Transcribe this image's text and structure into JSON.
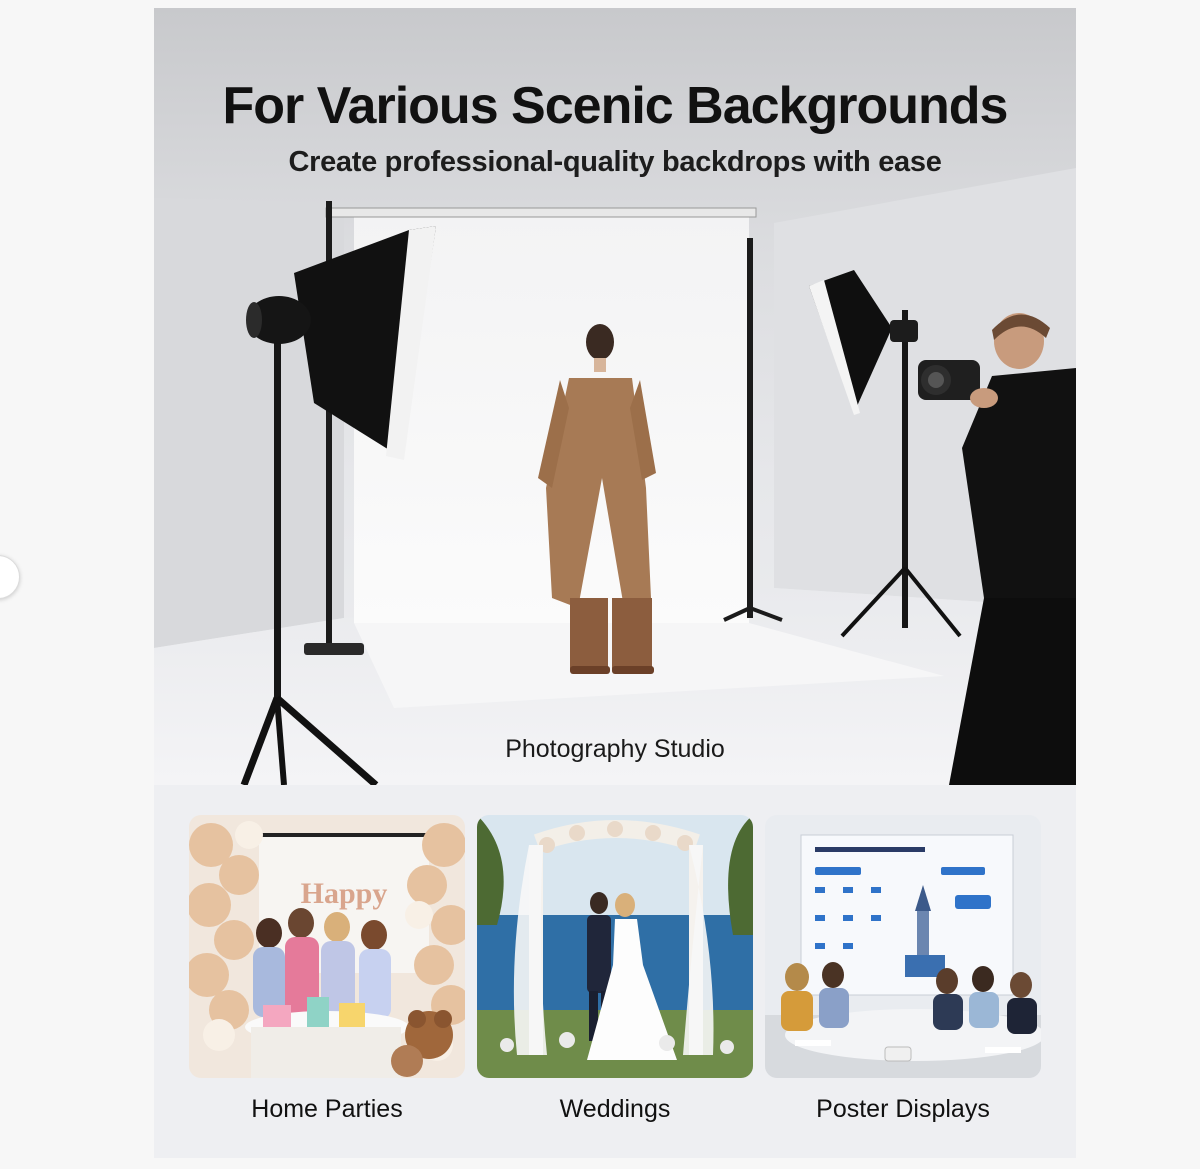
{
  "banner": {
    "title": "For Various Scenic Backgrounds",
    "subtitle": "Create professional-quality backdrops with ease",
    "hero_caption": "Photography Studio"
  },
  "thumbnails": [
    {
      "caption": "Home Parties",
      "sign_text": "Happy"
    },
    {
      "caption": "Weddings"
    },
    {
      "caption": "Poster Displays"
    }
  ],
  "colors": {
    "coat": "#a77a55",
    "backdrop": "#f5f5f5",
    "balloon": "#e6c2a0",
    "sea": "#2f6fa6",
    "accent_blue": "#2f73c9"
  },
  "icons": [
    "chevron-left-icon"
  ]
}
